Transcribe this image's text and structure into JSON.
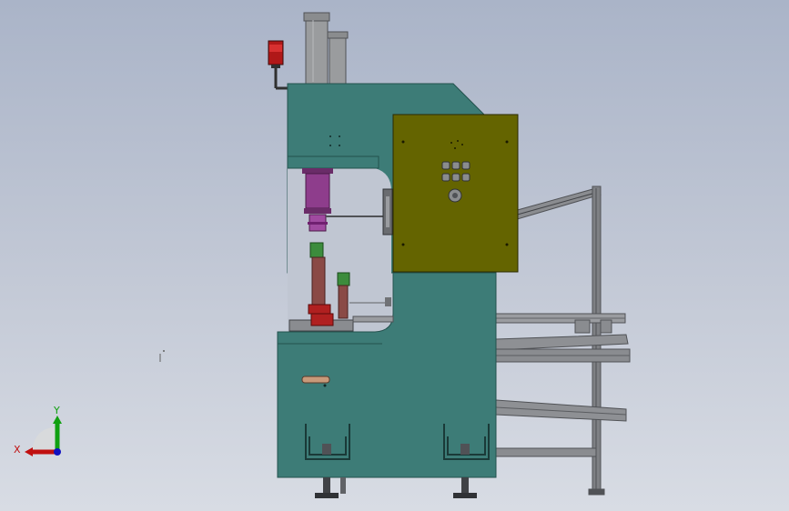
{
  "viewport": {
    "background_top": "#aab4c8",
    "background_bottom": "#d8dce4"
  },
  "machine": {
    "frame_color": "#3d7c77",
    "panel_color": "#646400",
    "cylinder_color": "#9a9c9e",
    "ram_color": "#8e3d8c",
    "tool_color": "#8a4a46",
    "green_collar_color": "#3c8c3c",
    "rail_color": "#8a8c90",
    "beacon_color": "#b01818",
    "control_buttons": 6
  },
  "triad": {
    "x_label": "X",
    "y_label": "Y",
    "x_color": "#c01010",
    "y_color": "#10a010",
    "z_color": "#1010c0"
  }
}
